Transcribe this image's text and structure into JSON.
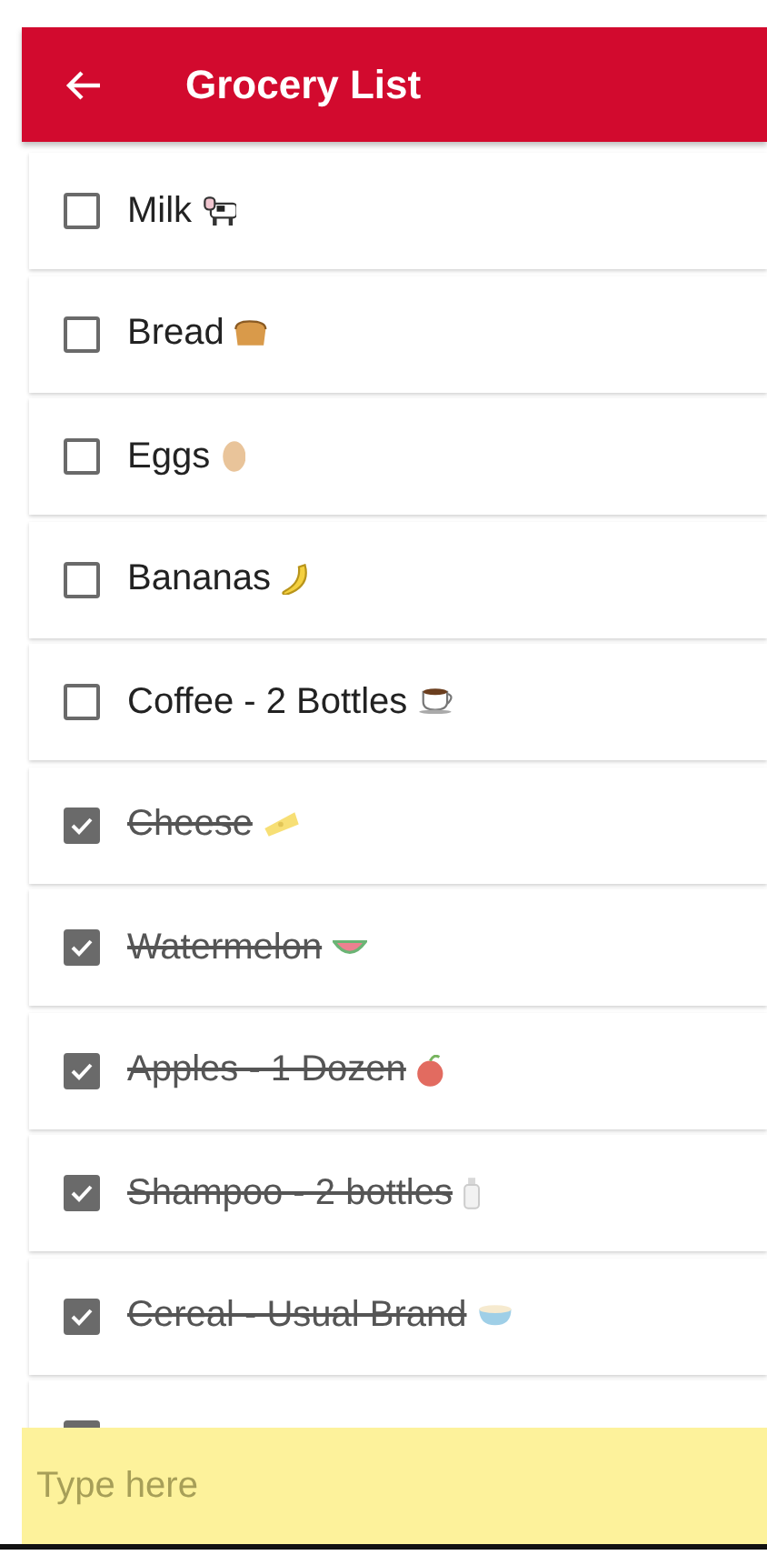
{
  "app_bar": {
    "title": "Grocery List"
  },
  "items": [
    {
      "label": "Milk",
      "checked": false
    },
    {
      "label": "Bread",
      "checked": false
    },
    {
      "label": "Eggs",
      "checked": false
    },
    {
      "label": "Bananas",
      "checked": false
    },
    {
      "label": "Coffee - 2 Bottles",
      "checked": false
    },
    {
      "label": "Cheese",
      "checked": true
    },
    {
      "label": "Watermelon",
      "checked": true
    },
    {
      "label": "Apples - 1 Dozen",
      "checked": true
    },
    {
      "label": "Shampoo - 2 bottles",
      "checked": true
    },
    {
      "label": "Cereal - Usual Brand",
      "checked": true
    },
    {
      "checked": true
    }
  ],
  "input": {
    "placeholder": "Type here"
  }
}
